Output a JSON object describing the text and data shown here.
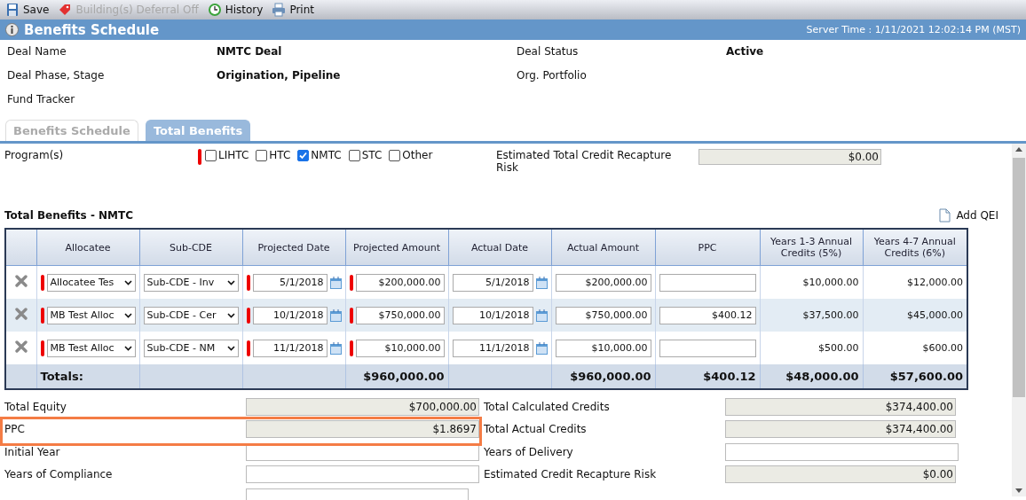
{
  "toolbar": [
    {
      "label": "Save",
      "kind": "save",
      "disabled": false
    },
    {
      "label": "Building(s) Deferral Off",
      "kind": "tag",
      "disabled": true
    },
    {
      "label": "History",
      "kind": "history",
      "disabled": false
    },
    {
      "label": "Print",
      "kind": "print",
      "disabled": false
    }
  ],
  "header": {
    "title": "Benefits Schedule",
    "server_time": "Server Time : 1/11/2021 12:02:14 PM (MST)"
  },
  "deal_info": [
    {
      "label": "Deal Name",
      "value": "NMTC Deal",
      "label_2": "Deal Status",
      "value_2": "Active"
    },
    {
      "label": "Deal Phase, Stage",
      "value": "Origination, Pipeline",
      "label_2": "Org. Portfolio"
    },
    {
      "label": "Fund Tracker"
    }
  ],
  "tabs": [
    {
      "label": "Benefits Schedule",
      "selected": false
    },
    {
      "label": "Total Benefits",
      "selected": true
    }
  ],
  "programs": {
    "label": "Program(s)",
    "required": true,
    "options": [
      {
        "label": "LIHTC",
        "checked": false
      },
      {
        "label": "HTC",
        "checked": false
      },
      {
        "label": "NMTC",
        "checked": true
      },
      {
        "label": "STC",
        "checked": false
      },
      {
        "label": "Other",
        "checked": false
      }
    ],
    "recapture_label": "Estimated Total Credit Recapture Risk",
    "recapture_value": "$0.00"
  },
  "section_title": "Total Benefits - NMTC",
  "add_button": "Add QEI",
  "table": {
    "columns": [
      {
        "label": "Allocatee",
        "required": true
      },
      {
        "label": "Sub-CDE",
        "required": false
      },
      {
        "label": "Projected Date",
        "required": true
      },
      {
        "label": "Projected Amount",
        "required": true
      },
      {
        "label": "Actual Date",
        "required": false
      },
      {
        "label": "Actual Amount",
        "required": false
      },
      {
        "label": "PPC",
        "required": false
      },
      {
        "label": "Years 1-3 Annual Credits (5%)",
        "required": false
      },
      {
        "label": "Years 4-7 Annual Credits (6%)",
        "required": false
      }
    ],
    "rows": [
      {
        "allocatee": "Allocatee Tes",
        "sub_cde": "Sub-CDE - Inv",
        "projected_date": "5/1/2018",
        "projected_amount": "$200,000.00",
        "actual_date": "5/1/2018",
        "actual_amount": "$200,000.00",
        "years_1_3": "$10,000.00",
        "years_4_7": "$12,000.00"
      },
      {
        "allocatee": "MB Test Alloc",
        "sub_cde": "Sub-CDE - Cer",
        "projected_date": "10/1/2018",
        "projected_amount": "$750,000.00",
        "actual_date": "10/1/2018",
        "actual_amount": "$750,000.00",
        "ppc": "$400.12",
        "years_1_3": "$37,500.00",
        "years_4_7": "$45,000.00"
      },
      {
        "allocatee": "MB Test Alloc",
        "sub_cde": "Sub-CDE - NM",
        "projected_date": "11/1/2018",
        "projected_amount": "$10,000.00",
        "actual_date": "11/1/2018",
        "actual_amount": "$10,000.00",
        "years_1_3": "$500.00",
        "years_4_7": "$600.00"
      }
    ],
    "totals": {
      "label": "Totals:",
      "projected_amount": "$960,000.00",
      "actual_amount": "$960,000.00",
      "ppc": "$400.12",
      "years_1_3": "$48,000.00",
      "years_4_7": "$57,600.00"
    }
  },
  "summary_left": [
    {
      "label": "Total Equity",
      "value": "$700,000.00",
      "readonly": true,
      "highlighted": false
    },
    {
      "label": "PPC",
      "value": "$1.8697",
      "readonly": true,
      "highlighted": true
    },
    {
      "label": "Initial Year",
      "readonly": false,
      "highlighted": false
    },
    {
      "label": "Years of Compliance",
      "readonly": false,
      "highlighted": false
    },
    {
      "readonly": false,
      "highlighted": false
    }
  ],
  "summary_right": [
    {
      "label": "Total Calculated Credits",
      "value": "$374,400.00",
      "readonly": true
    },
    {
      "label": "Total Actual Credits",
      "value": "$374,400.00",
      "readonly": true
    },
    {
      "label": "Years of Delivery",
      "readonly": false
    },
    {
      "label": "Estimated Credit Recapture Risk",
      "value": "$0.00",
      "readonly": true
    }
  ]
}
